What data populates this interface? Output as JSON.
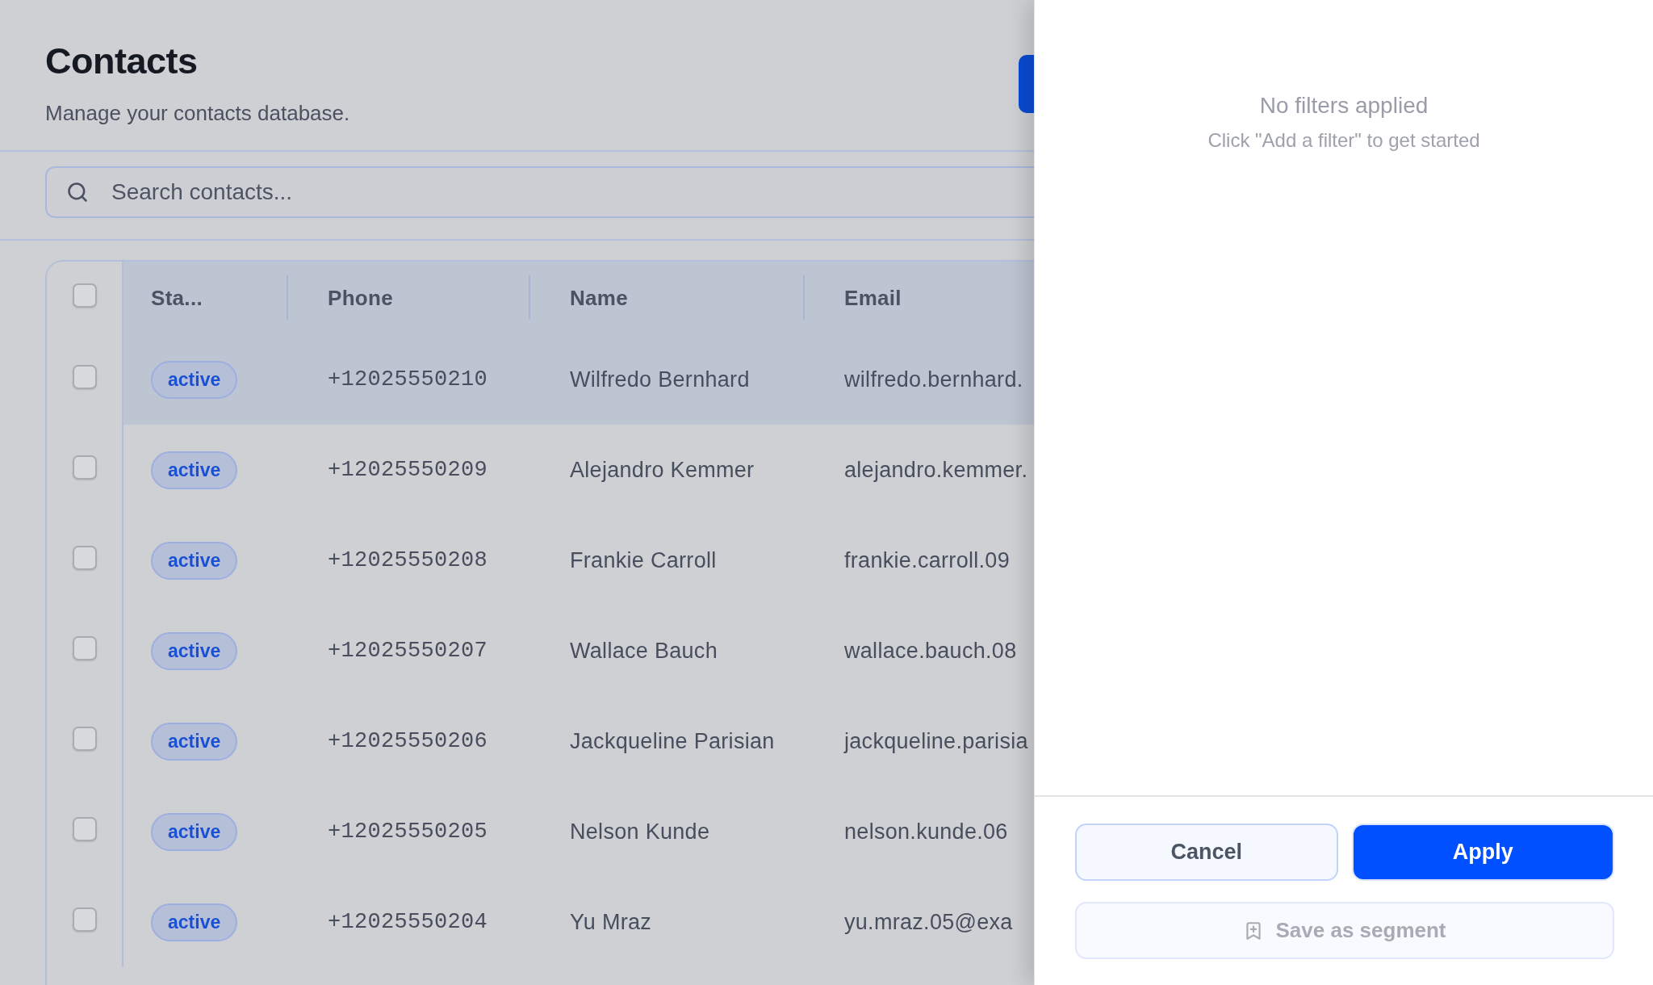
{
  "page": {
    "title": "Contacts",
    "subtitle": "Manage your contacts database."
  },
  "search": {
    "placeholder": "Search contacts..."
  },
  "table": {
    "select_all": {
      "checked": false
    },
    "columns": [
      "Sta...",
      "Phone",
      "Name",
      "Email"
    ],
    "rows": [
      {
        "checked": false,
        "highlighted": true,
        "status": "active",
        "phone": "+12025550210",
        "name": "Wilfredo Bernhard",
        "email": "wilfredo.bernhard."
      },
      {
        "checked": false,
        "highlighted": false,
        "status": "active",
        "phone": "+12025550209",
        "name": "Alejandro Kemmer",
        "email": "alejandro.kemmer."
      },
      {
        "checked": false,
        "highlighted": false,
        "status": "active",
        "phone": "+12025550208",
        "name": "Frankie Carroll",
        "email": "frankie.carroll.09"
      },
      {
        "checked": false,
        "highlighted": false,
        "status": "active",
        "phone": "+12025550207",
        "name": "Wallace Bauch",
        "email": "wallace.bauch.08"
      },
      {
        "checked": false,
        "highlighted": false,
        "status": "active",
        "phone": "+12025550206",
        "name": "Jackqueline Parisian",
        "email": "jackqueline.parisia"
      },
      {
        "checked": false,
        "highlighted": false,
        "status": "active",
        "phone": "+12025550205",
        "name": "Nelson Kunde",
        "email": "nelson.kunde.06"
      },
      {
        "checked": false,
        "highlighted": false,
        "status": "active",
        "phone": "+12025550204",
        "name": "Yu Mraz",
        "email": "yu.mraz.05@exa"
      }
    ]
  },
  "filter_panel": {
    "empty_title": "No filters applied",
    "empty_hint": "Click \"Add a filter\" to get started",
    "cancel_button": {
      "label": "Cancel"
    },
    "apply_button": {
      "label": "Apply"
    },
    "save_segment_button": {
      "label": "Save as segment",
      "disabled": true
    }
  }
}
